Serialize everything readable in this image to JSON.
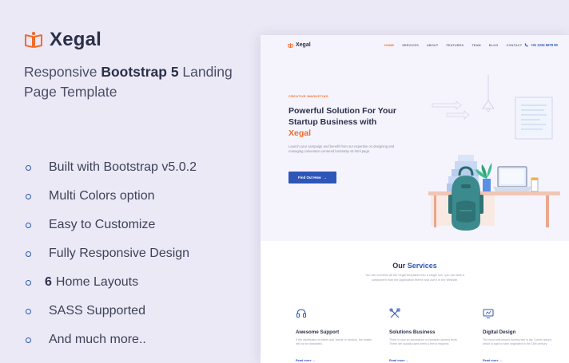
{
  "promo": {
    "brand": "Xegal",
    "tagline_before": "Responsive ",
    "tagline_bold": "Bootstrap 5",
    "tagline_after": " Landing Page Template",
    "features": [
      {
        "bold": "",
        "text": "Built with Bootstrap v5.0.2"
      },
      {
        "bold": "",
        "text": "Multi Colors option"
      },
      {
        "bold": "",
        "text": "Easy to Customize"
      },
      {
        "bold": "",
        "text": "Fully Responsive Design"
      },
      {
        "bold": "6",
        "text": "Home Layouts"
      },
      {
        "bold": "",
        "text": "SASS Supported"
      },
      {
        "bold": "",
        "text": "And much more.."
      }
    ]
  },
  "preview": {
    "nav": {
      "brand": "Xegal",
      "links": [
        "HOME",
        "SERVICES",
        "ABOUT",
        "FEATURES",
        "TEAM",
        "BLOG",
        "CONTACT"
      ],
      "active_link": "HOME",
      "phone": "+01 1234 5678 90"
    },
    "hero": {
      "eyebrow": "CREATIVE MARKETING",
      "headline": "Powerful Solution For Your Startup Business with",
      "headline_accent": "Xegal",
      "description": "Launch your campaign and benefit from our expertise on designing and managing conversion centered bootstrap v5 html page.",
      "button_label": "Find Out How",
      "button_arrow": "→"
    },
    "services": {
      "title_plain": "Our ",
      "title_accent": "Services",
      "subtitle": "You can combine all the Xegal templates into a single one, you can take a component from the Application theme and use it in the Website.",
      "cards": [
        {
          "icon": "headset-icon",
          "title": "Awesome Support",
          "desc": "If the distribution of letters and 'words' is random, the reader will not be distracted.",
          "link": "Read more →"
        },
        {
          "icon": "tools-icon",
          "title": "Solutions Business",
          "desc": "There is now an abundance of readable dummy texts. These are usually used when a text is required.",
          "link": "Read more →"
        },
        {
          "icon": "monitor-design-icon",
          "title": "Digital Design",
          "desc": "The most well-known dummy text is the 'Lorem Ipsum', which is said to have originated in the 16th century.",
          "link": "Read more →"
        }
      ]
    }
  },
  "colors": {
    "accent_orange": "#f26b2a",
    "primary_blue": "#2e56b8",
    "background": "#ebe9f6"
  }
}
